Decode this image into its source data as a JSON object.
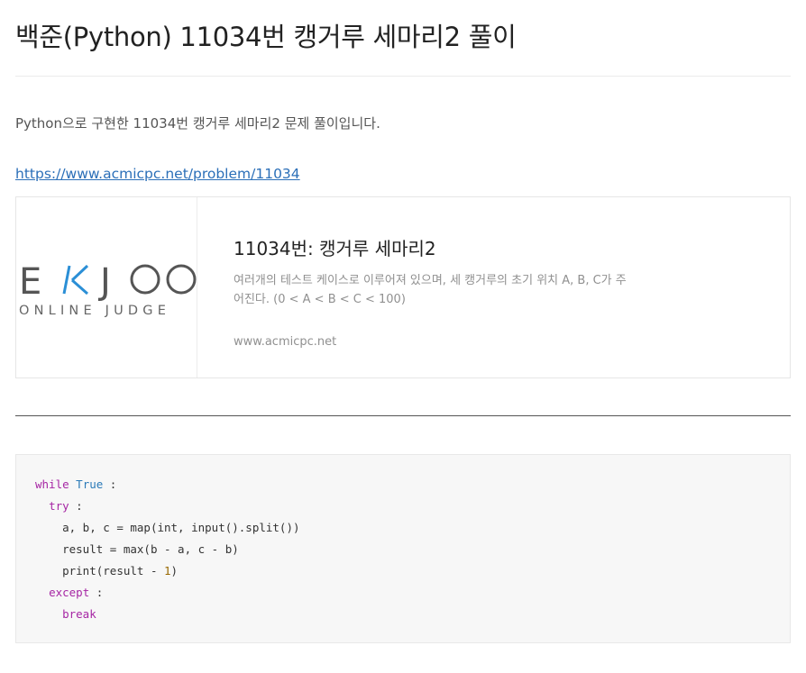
{
  "post": {
    "title": "백준(Python) 11034번 캥거루 세마리2 풀이",
    "intro": "Python으로 구현한 11034번 캥거루 세마리2 문제 풀이입니다.",
    "link": "https://www.acmicpc.net/problem/11034"
  },
  "card": {
    "logo_main": "E K J O O",
    "logo_sub": "ONLINE JUDGE",
    "logo_accent": "#2b8fd6",
    "title": "11034번: 캥거루 세마리2",
    "desc_line1": "여러개의 테스트 케이스로 이루어져 있으며, 세 캥거루의 초기 위치 A, B, C가 주",
    "desc_line2": "어진다. (0 < A < B < C < 100)",
    "domain": "www.acmicpc.net"
  },
  "code": {
    "l1_kw": "while",
    "l1_bi": "True",
    "l1_rest": " :",
    "l2_kw": "try",
    "l2_rest": " :",
    "l3": "a, b, c = map(int, input().split())",
    "l4": "result = max(b - a, c - b)",
    "l5_pre": "print(result - ",
    "l5_num": "1",
    "l5_post": ")",
    "l6_kw": "except",
    "l6_rest": " :",
    "l7_kw": "break"
  },
  "colors": {
    "keyword": "#a626a4",
    "builtin": "#2b7ab8",
    "number": "#986801",
    "link": "#2b6fb8"
  }
}
